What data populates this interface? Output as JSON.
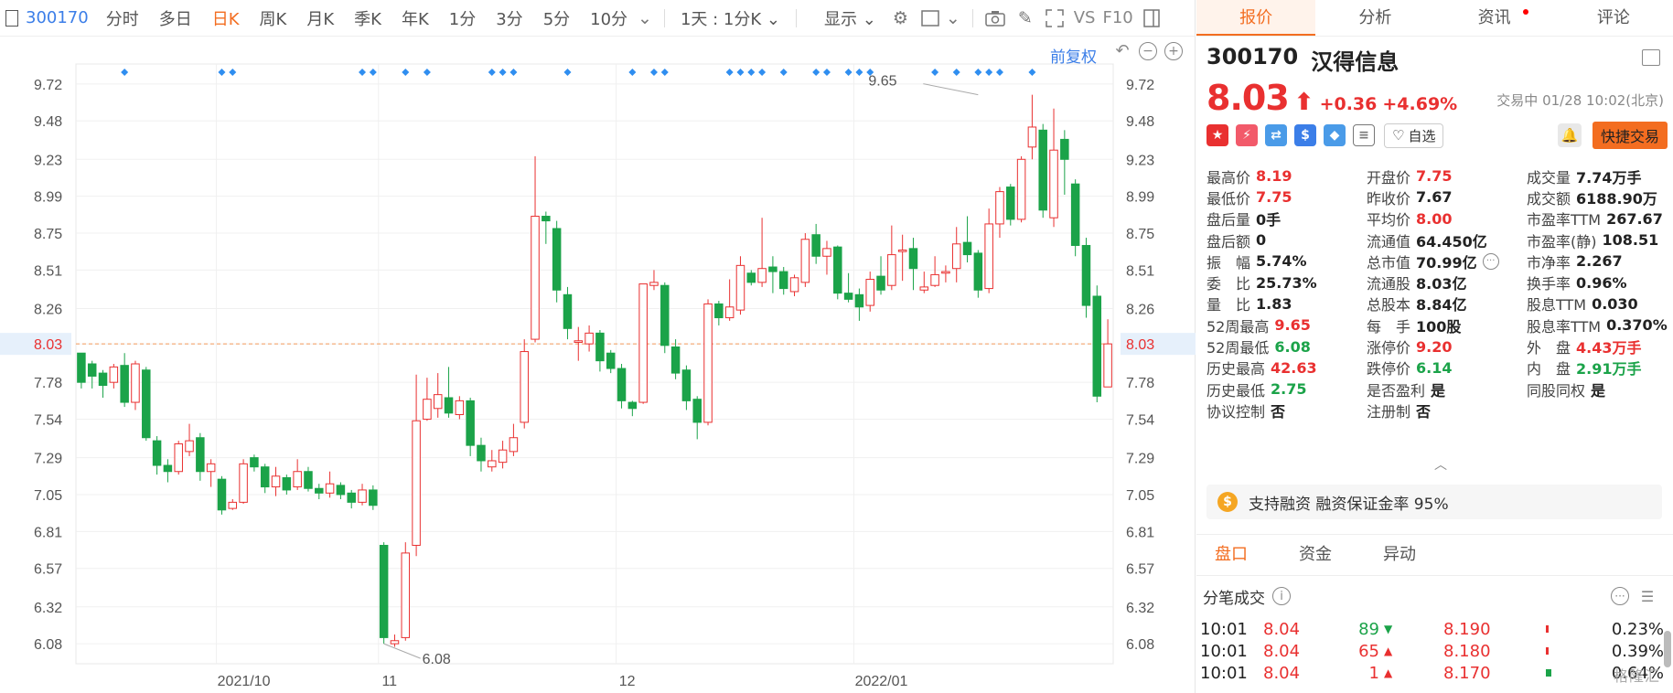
{
  "toolbar": {
    "code": "300170",
    "items": [
      "分时",
      "多日",
      "日K",
      "周K",
      "月K",
      "季K",
      "年K",
      "1分",
      "3分",
      "5分",
      "10分"
    ],
    "active_index": 2,
    "interval_select": "1天 : 1分K",
    "display_label": "显示",
    "vs": "VS",
    "f10": "F10"
  },
  "chart": {
    "fuquan": "前复权",
    "high_label": "9.65",
    "low_label": "6.08",
    "price_line_label": "8.03",
    "y_ticks": [
      "9.72",
      "9.48",
      "9.23",
      "8.99",
      "8.75",
      "8.51",
      "8.26",
      "8.03",
      "7.78",
      "7.54",
      "7.29",
      "7.05",
      "6.81",
      "6.57",
      "6.32",
      "6.08"
    ],
    "x_labels": [
      "2021/10",
      "11",
      "12",
      "2022/01"
    ]
  },
  "chart_data": {
    "type": "candlestick",
    "title": "",
    "ylim": [
      5.95,
      9.85
    ],
    "current_price": 8.03,
    "x_ticks": [
      {
        "label": "2021/10",
        "index": 13
      },
      {
        "label": "11",
        "index": 28
      },
      {
        "label": "12",
        "index": 50
      },
      {
        "label": "2022/01",
        "index": 72
      }
    ],
    "annotations": [
      {
        "text": "9.65",
        "index": 83,
        "value": 9.65
      },
      {
        "text": "6.08",
        "index": 28,
        "value": 6.08
      }
    ],
    "markers_top_index": [
      4,
      13,
      14,
      26,
      27,
      30,
      32,
      38,
      39,
      40,
      45,
      51,
      53,
      54,
      60,
      61,
      62,
      63,
      65,
      68,
      69,
      71,
      72,
      73,
      79,
      81,
      83,
      84,
      85,
      88
    ],
    "candles": [
      [
        7.97,
        7.78,
        7.97,
        7.74
      ],
      [
        7.9,
        7.82,
        7.92,
        7.74
      ],
      [
        7.84,
        7.76,
        7.86,
        7.68
      ],
      [
        7.78,
        7.88,
        7.9,
        7.74
      ],
      [
        7.89,
        7.65,
        7.97,
        7.62
      ],
      [
        7.65,
        7.9,
        7.92,
        7.6
      ],
      [
        7.86,
        7.42,
        7.88,
        7.4
      ],
      [
        7.4,
        7.24,
        7.43,
        7.18
      ],
      [
        7.24,
        7.2,
        7.28,
        7.13
      ],
      [
        7.2,
        7.38,
        7.4,
        7.18
      ],
      [
        7.33,
        7.4,
        7.51,
        7.3
      ],
      [
        7.42,
        7.2,
        7.45,
        7.14
      ],
      [
        7.2,
        7.25,
        7.28,
        7.1
      ],
      [
        7.15,
        6.95,
        7.17,
        6.92
      ],
      [
        6.96,
        7.0,
        7.02,
        6.95
      ],
      [
        7.0,
        7.25,
        7.28,
        6.99
      ],
      [
        7.29,
        7.23,
        7.31,
        7.2
      ],
      [
        7.23,
        7.1,
        7.25,
        7.06
      ],
      [
        7.1,
        7.17,
        7.23,
        7.04
      ],
      [
        7.16,
        7.08,
        7.18,
        7.05
      ],
      [
        7.1,
        7.2,
        7.28,
        7.08
      ],
      [
        7.2,
        7.09,
        7.23,
        7.07
      ],
      [
        7.09,
        7.06,
        7.12,
        7.02
      ],
      [
        7.06,
        7.12,
        7.2,
        7.03
      ],
      [
        7.11,
        7.05,
        7.13,
        7.02
      ],
      [
        7.06,
        7.0,
        7.08,
        6.96
      ],
      [
        7.0,
        7.08,
        7.12,
        6.98
      ],
      [
        7.08,
        6.98,
        7.11,
        6.95
      ],
      [
        6.72,
        6.12,
        6.74,
        6.08
      ],
      [
        6.08,
        6.1,
        6.14,
        6.06
      ],
      [
        6.12,
        6.67,
        6.74,
        6.1
      ],
      [
        6.72,
        7.53,
        7.83,
        6.65
      ],
      [
        7.54,
        7.67,
        7.81,
        7.53
      ],
      [
        7.61,
        7.7,
        7.84,
        7.55
      ],
      [
        7.68,
        7.58,
        7.88,
        7.55
      ],
      [
        7.57,
        7.66,
        7.69,
        7.54
      ],
      [
        7.66,
        7.37,
        7.68,
        7.3
      ],
      [
        7.37,
        7.27,
        7.42,
        7.2
      ],
      [
        7.23,
        7.27,
        7.34,
        7.2
      ],
      [
        7.26,
        7.34,
        7.4,
        7.22
      ],
      [
        7.33,
        7.42,
        7.51,
        7.3
      ],
      [
        7.52,
        7.98,
        8.06,
        7.48
      ],
      [
        8.06,
        8.86,
        9.25,
        8.04
      ],
      [
        8.86,
        8.83,
        8.89,
        8.68
      ],
      [
        8.78,
        8.38,
        8.83,
        8.3
      ],
      [
        8.35,
        8.13,
        8.4,
        8.06
      ],
      [
        8.04,
        8.05,
        8.14,
        7.92
      ],
      [
        8.03,
        8.1,
        8.15,
        7.98
      ],
      [
        8.1,
        7.92,
        8.12,
        7.85
      ],
      [
        7.97,
        7.87,
        7.99,
        7.84
      ],
      [
        7.87,
        7.66,
        7.9,
        7.61
      ],
      [
        7.65,
        7.61,
        7.66,
        7.56
      ],
      [
        7.65,
        8.42,
        8.42,
        7.64
      ],
      [
        8.41,
        8.43,
        8.51,
        8.38
      ],
      [
        8.41,
        8.02,
        8.43,
        7.97
      ],
      [
        8.01,
        7.84,
        8.06,
        7.8
      ],
      [
        7.86,
        7.66,
        7.89,
        7.6
      ],
      [
        7.67,
        7.52,
        7.69,
        7.41
      ],
      [
        7.52,
        8.29,
        8.32,
        7.5
      ],
      [
        8.29,
        8.2,
        8.31,
        8.15
      ],
      [
        8.2,
        8.27,
        8.45,
        8.18
      ],
      [
        8.25,
        8.54,
        8.6,
        8.22
      ],
      [
        8.49,
        8.43,
        8.51,
        8.41
      ],
      [
        8.43,
        8.52,
        8.85,
        8.4
      ],
      [
        8.53,
        8.5,
        8.6,
        8.36
      ],
      [
        8.5,
        8.39,
        8.53,
        8.35
      ],
      [
        8.37,
        8.46,
        8.48,
        8.34
      ],
      [
        8.43,
        8.71,
        8.75,
        8.4
      ],
      [
        8.74,
        8.6,
        8.81,
        8.55
      ],
      [
        8.6,
        8.65,
        8.7,
        8.48
      ],
      [
        8.66,
        8.36,
        8.67,
        8.32
      ],
      [
        8.36,
        8.32,
        8.49,
        8.3
      ],
      [
        8.35,
        8.27,
        8.39,
        8.18
      ],
      [
        8.28,
        8.45,
        8.5,
        8.24
      ],
      [
        8.47,
        8.38,
        8.6,
        8.35
      ],
      [
        8.41,
        8.61,
        8.8,
        8.38
      ],
      [
        8.63,
        8.64,
        8.74,
        8.44
      ],
      [
        8.65,
        8.52,
        8.72,
        8.38
      ],
      [
        8.38,
        8.4,
        8.5,
        8.36
      ],
      [
        8.41,
        8.48,
        8.6,
        8.4
      ],
      [
        8.49,
        8.5,
        8.54,
        8.43
      ],
      [
        8.52,
        8.68,
        8.79,
        8.43
      ],
      [
        8.69,
        8.61,
        8.86,
        8.56
      ],
      [
        8.62,
        8.38,
        8.64,
        8.33
      ],
      [
        8.39,
        8.81,
        8.91,
        8.36
      ],
      [
        8.81,
        9.02,
        9.05,
        8.72
      ],
      [
        9.05,
        8.84,
        9.07,
        8.8
      ],
      [
        8.84,
        9.23,
        9.25,
        8.82
      ],
      [
        9.31,
        9.44,
        9.65,
        9.23
      ],
      [
        9.42,
        8.9,
        9.46,
        8.85
      ],
      [
        8.85,
        9.29,
        9.56,
        8.79
      ],
      [
        9.36,
        9.23,
        9.42,
        9.0
      ],
      [
        9.07,
        8.67,
        9.1,
        8.6
      ],
      [
        8.67,
        8.28,
        8.72,
        8.2
      ],
      [
        8.34,
        7.69,
        8.41,
        7.65
      ],
      [
        7.75,
        8.03,
        8.19,
        7.75
      ]
    ]
  },
  "tabs": [
    "报价",
    "分析",
    "资讯",
    "评论"
  ],
  "stock": {
    "code": "300170",
    "name": "汉得信息",
    "price": "8.03",
    "arrow": "⬆",
    "change": "+0.36",
    "change_pct": "+4.69%",
    "status": "交易中 01/28 10:02(北京)",
    "zixuan": "自选",
    "quick_trade": "快捷交易"
  },
  "stats": [
    [
      {
        "label": "最高价",
        "value": "8.19",
        "color": "red"
      },
      {
        "label": "开盘价",
        "value": "7.75",
        "color": "red"
      },
      {
        "label": "成交量",
        "value": "7.74万手",
        "color": "blk"
      }
    ],
    [
      {
        "label": "最低价",
        "value": "7.75",
        "color": "red"
      },
      {
        "label": "昨收价",
        "value": "7.67",
        "color": "blk"
      },
      {
        "label": "成交额",
        "value": "6188.90万",
        "color": "blk"
      }
    ],
    [
      {
        "label": "盘后量",
        "value": "0手",
        "color": "blk"
      },
      {
        "label": "平均价",
        "value": "8.00",
        "color": "red"
      },
      {
        "label": "市盈率TTM",
        "value": "267.67",
        "color": "blk"
      }
    ],
    [
      {
        "label": "盘后额",
        "value": "0",
        "color": "blk"
      },
      {
        "label": "流通值",
        "value": "64.450亿",
        "color": "blk"
      },
      {
        "label": "市盈率(静)",
        "value": "108.51",
        "color": "blk"
      }
    ],
    [
      {
        "label": "振　幅",
        "value": "5.74%",
        "color": "blk"
      },
      {
        "label": "总市值",
        "value": "70.99亿",
        "color": "blk"
      },
      {
        "label": "市净率",
        "value": "2.267",
        "color": "blk"
      }
    ],
    [
      {
        "label": "委　比",
        "value": "25.73%",
        "color": "blk"
      },
      {
        "label": "流通股",
        "value": "8.03亿",
        "color": "blk"
      },
      {
        "label": "换手率",
        "value": "0.96%",
        "color": "blk"
      }
    ],
    [
      {
        "label": "量　比",
        "value": "1.83",
        "color": "blk"
      },
      {
        "label": "总股本",
        "value": "8.84亿",
        "color": "blk"
      },
      {
        "label": "股息TTM",
        "value": "0.030",
        "color": "blk"
      }
    ],
    [
      {
        "label": "52周最高",
        "value": "9.65",
        "color": "red"
      },
      {
        "label": "每　手",
        "value": "100股",
        "color": "blk"
      },
      {
        "label": "股息率TTM",
        "value": "0.370%",
        "color": "blk"
      }
    ],
    [
      {
        "label": "52周最低",
        "value": "6.08",
        "color": "green"
      },
      {
        "label": "涨停价",
        "value": "9.20",
        "color": "red"
      },
      {
        "label": "外　盘",
        "value": "4.43万手",
        "color": "red"
      }
    ],
    [
      {
        "label": "历史最高",
        "value": "42.63",
        "color": "red"
      },
      {
        "label": "跌停价",
        "value": "6.14",
        "color": "green"
      },
      {
        "label": "内　盘",
        "value": "2.91万手",
        "color": "green"
      }
    ],
    [
      {
        "label": "历史最低",
        "value": "2.75",
        "color": "green"
      },
      {
        "label": "是否盈利",
        "value": "是",
        "color": "blk"
      },
      {
        "label": "同股同权",
        "value": "是",
        "color": "blk"
      }
    ],
    [
      {
        "label": "协议控制",
        "value": "否",
        "color": "blk"
      },
      {
        "label": "注册制",
        "value": "否",
        "color": "blk"
      },
      {
        "label": "",
        "value": "",
        "color": "blk"
      }
    ]
  ],
  "margin_banner": {
    "label": "支持融资 融资保证金率 95%"
  },
  "subtabs": [
    "盘口",
    "资金",
    "异动"
  ],
  "fenbi_title": "分笔成交",
  "trades": [
    {
      "time": "10:01",
      "price": "8.04",
      "vol": "89",
      "dir": "down",
      "book": "8.190",
      "bar": "red",
      "pct": "0.23%"
    },
    {
      "time": "10:01",
      "price": "8.04",
      "vol": "65",
      "dir": "up",
      "book": "8.180",
      "bar": "red",
      "pct": "0.39%"
    },
    {
      "time": "10:01",
      "price": "8.04",
      "vol": "1",
      "dir": "up",
      "book": "8.170",
      "bar": "green",
      "pct": "0.64%"
    }
  ],
  "watermark": "格隆汇"
}
